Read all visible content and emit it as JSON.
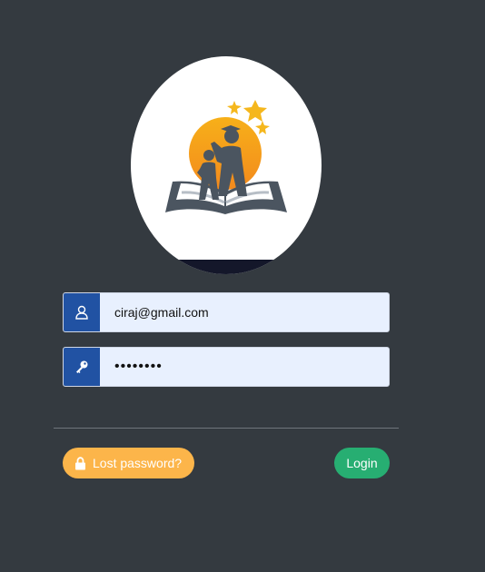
{
  "logo": {
    "icon": "graduation-book-logo"
  },
  "form": {
    "username": {
      "value": "ciraj@gmail.com",
      "icon": "user-icon"
    },
    "password": {
      "value": "••••••••",
      "icon": "key-icon"
    }
  },
  "actions": {
    "lost_password_label": "Lost password?",
    "lost_password_icon": "lock-icon",
    "login_label": "Login"
  },
  "colors": {
    "background": "#343a40",
    "input_addon": "#2152a3",
    "input_bg": "#e8f0fe",
    "lost_btn": "#fcb54a",
    "login_btn": "#27ae72"
  }
}
